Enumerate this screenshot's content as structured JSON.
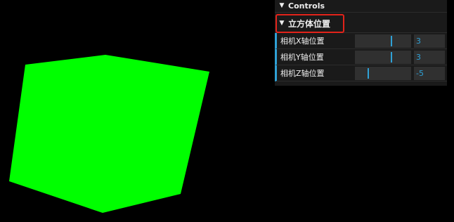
{
  "scene": {
    "background": "#000000",
    "cube_color": "#00ff00"
  },
  "gui": {
    "root_title": "Controls",
    "folder": {
      "title": "立方体位置"
    },
    "controls": [
      {
        "label": "相机X轴位置",
        "value": "3"
      },
      {
        "label": "相机Y轴位置",
        "value": "3"
      },
      {
        "label": "相机Z轴位置",
        "value": "-5"
      }
    ],
    "accent_color": "#2fa1d6",
    "highlight_color": "#e2231a"
  }
}
